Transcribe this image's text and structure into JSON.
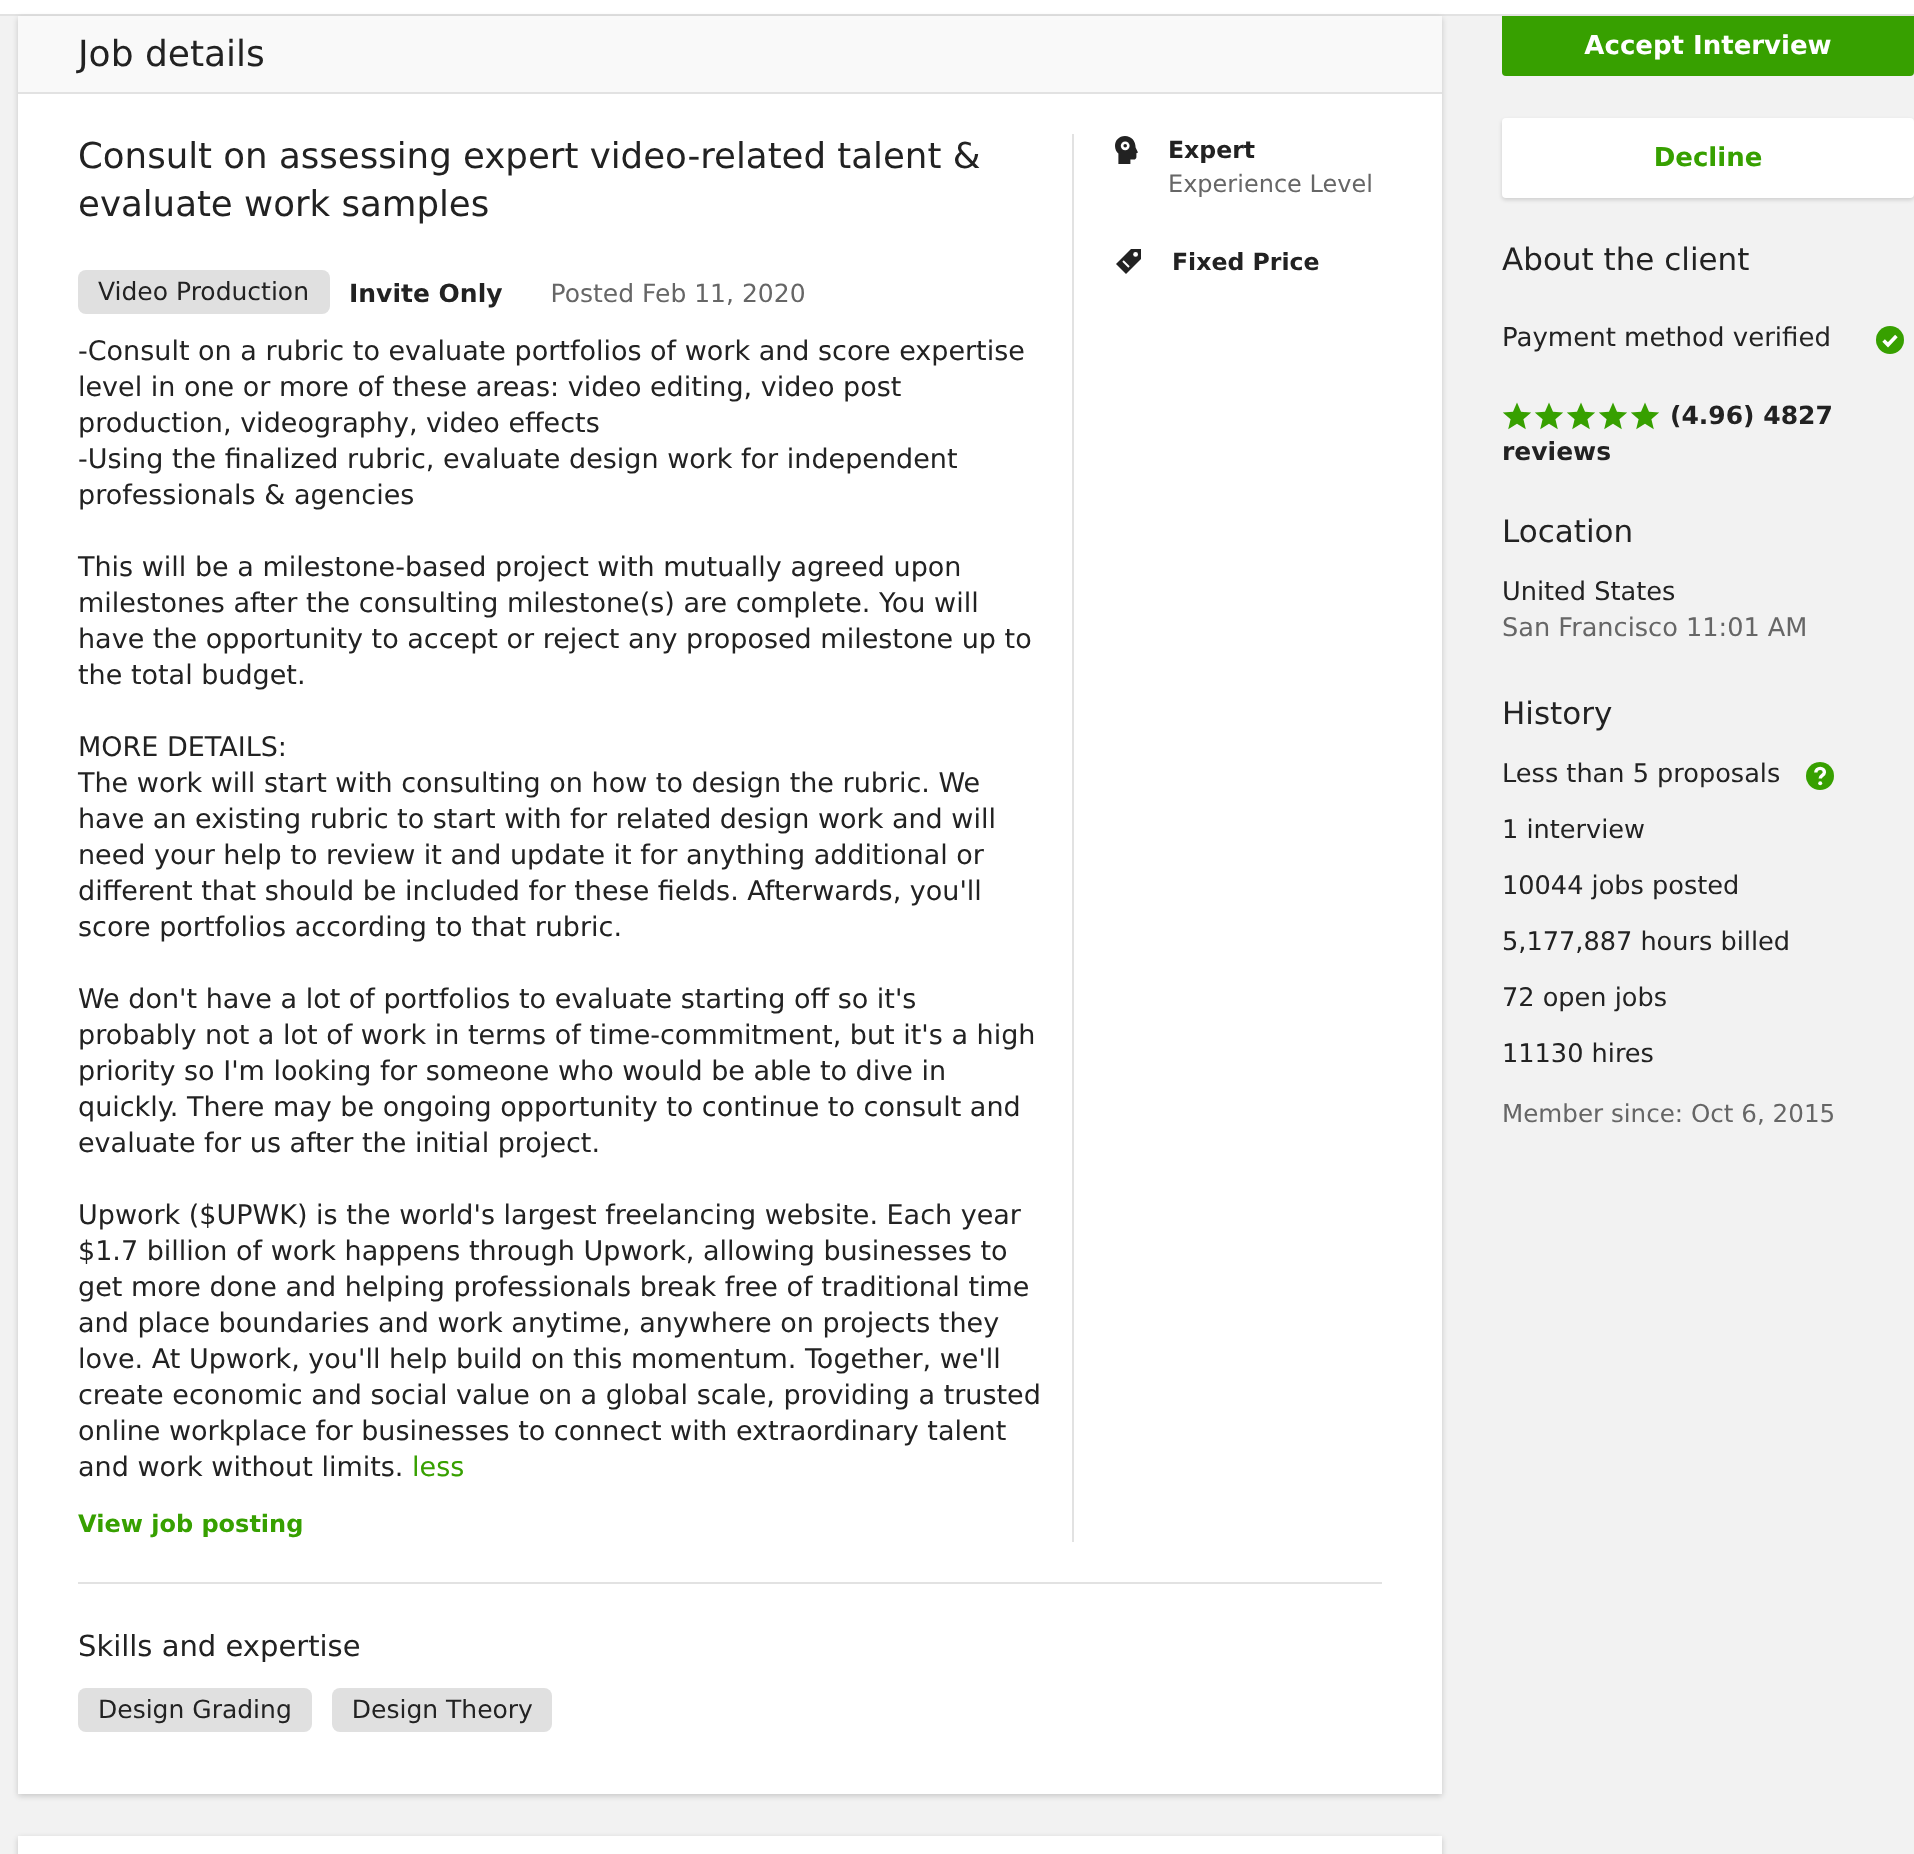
{
  "job_details": {
    "heading": "Job details",
    "title": "Consult on assessing expert video-related talent & evaluate work samples",
    "category": "Video Production",
    "visibility": "Invite Only",
    "posted": "Posted Feb 11, 2020",
    "description": [
      {
        "lines": [
          "-Consult on a rubric to evaluate portfolios of work and score expertise level in one or more of these areas: video editing, video post production, videography, video effects",
          "-Using the finalized rubric, evaluate design work for independent professionals & agencies"
        ]
      },
      {
        "lines": [
          "This will be a milestone-based project with mutually agreed upon milestones after the consulting milestone(s) are complete. You will have the opportunity to accept or reject any proposed milestone up to the total budget."
        ]
      },
      {
        "lines": [
          "MORE DETAILS:",
          "The work will start with consulting on how to design the rubric. We have an existing rubric to start with for related design work and will need your help to review it and update it for anything additional or different that should be included for these fields. Afterwards, you'll score portfolios according to that rubric."
        ]
      },
      {
        "lines": [
          "We don't have a lot of portfolios to evaluate starting off so it's probably not a lot of work in terms of time-commitment, but it's a high priority so I'm looking for someone who would be able to dive in quickly. There may be ongoing opportunity to continue to consult and evaluate for us after the initial project."
        ]
      },
      {
        "lines": [
          "Upwork ($UPWK) is the world's largest freelancing website. Each year $1.7 billion of work happens through Upwork, allowing businesses to get more done and helping professionals break free of traditional time and place boundaries and work anytime, anywhere on projects they love. At Upwork, you'll help build on this momentum. Together, we'll create economic and social value on a global scale, providing a trusted online workplace for businesses to connect with extraordinary talent and work without limits."
        ]
      }
    ],
    "less_link": "less",
    "view_link": "View job posting",
    "features": [
      {
        "kind": "experience",
        "title": "Expert",
        "subtitle": "Experience Level"
      },
      {
        "kind": "budget",
        "title": "Fixed Price"
      }
    ],
    "skills": {
      "heading": "Skills and expertise",
      "tags": [
        "Design Grading",
        "Design Theory"
      ]
    }
  },
  "actions": {
    "accept": "Accept Interview",
    "decline": "Decline"
  },
  "client": {
    "heading": "About the client",
    "payment": {
      "text": "Payment method verified",
      "verified": true
    },
    "rating": {
      "stars": 5,
      "lines": [
        "(4.96) 4827",
        "reviews"
      ]
    },
    "location": {
      "heading": "Location",
      "country": "United States",
      "city_time": "San Francisco 11:01 AM"
    },
    "history": {
      "heading": "History",
      "items": [
        {
          "text": "Less than 5 proposals",
          "help": true
        },
        {
          "text": "1 interview",
          "help": false
        },
        {
          "text": "10044 jobs posted",
          "help": false
        },
        {
          "text": "5,177,887 hours billed",
          "help": false
        },
        {
          "text": "72 open jobs",
          "help": false
        },
        {
          "text": "11130 hires",
          "help": false
        }
      ],
      "member_since": "Member since: Oct 6, 2015"
    }
  }
}
